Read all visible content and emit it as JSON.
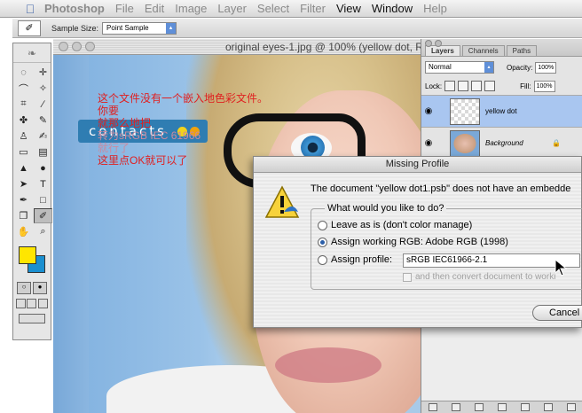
{
  "menubar": {
    "app": "Photoshop",
    "items": [
      {
        "label": "File",
        "active": false
      },
      {
        "label": "Edit",
        "active": false
      },
      {
        "label": "Image",
        "active": false
      },
      {
        "label": "Layer",
        "active": false
      },
      {
        "label": "Select",
        "active": false
      },
      {
        "label": "Filter",
        "active": false
      },
      {
        "label": "View",
        "active": true
      },
      {
        "label": "Window",
        "active": true
      },
      {
        "label": "Help",
        "active": false
      }
    ]
  },
  "options_bar": {
    "sample_size_label": "Sample Size:",
    "sample_size_value": "Point Sample",
    "tool_icon": "eyedropper-icon"
  },
  "document": {
    "title": "original eyes-1.jpg @ 100% (yellow dot, R",
    "contacts_text": "contacts",
    "annotation": {
      "lines": [
        "这个文件没有一个嵌入地色彩文件。",
        "你要",
        "就那么地把",
        "",
        "这里点OK就可以了"
      ],
      "overlap_a": "转为",
      "overlap_b": "sRGB IEC 61966",
      "overlap_c": "就行了"
    }
  },
  "layers_panel": {
    "tabs": [
      "Layers",
      "Channels",
      "Paths"
    ],
    "blend_mode": "Normal",
    "opacity_label": "Opacity:",
    "opacity_value": "100%",
    "lock_label": "Lock:",
    "fill_label": "Fill:",
    "fill_value": "100%",
    "layers": [
      {
        "name": "yellow dot",
        "selected": true
      },
      {
        "name": "Background",
        "selected": false
      }
    ]
  },
  "dialog": {
    "title": "Missing Profile",
    "message": "The document \"yellow dot1.psb\" does not have an embedde",
    "question": "What would you like to do?",
    "options": [
      {
        "label": "Leave as is (don't color manage)",
        "selected": false
      },
      {
        "label": "Assign working RGB:  Adobe RGB (1998)",
        "selected": true
      },
      {
        "label": "Assign profile:",
        "selected": false
      }
    ],
    "profile_value": "sRGB IEC61966-2.1",
    "convert_label": "and then convert document to worki",
    "cancel_label": "Cancel"
  },
  "colors": {
    "foreground": "#ffe600",
    "background": "#1a8fd0",
    "annotation_red": "#e02020",
    "layer_selected": "#a9c6f0",
    "contacts_bar": "#2f7db2"
  }
}
